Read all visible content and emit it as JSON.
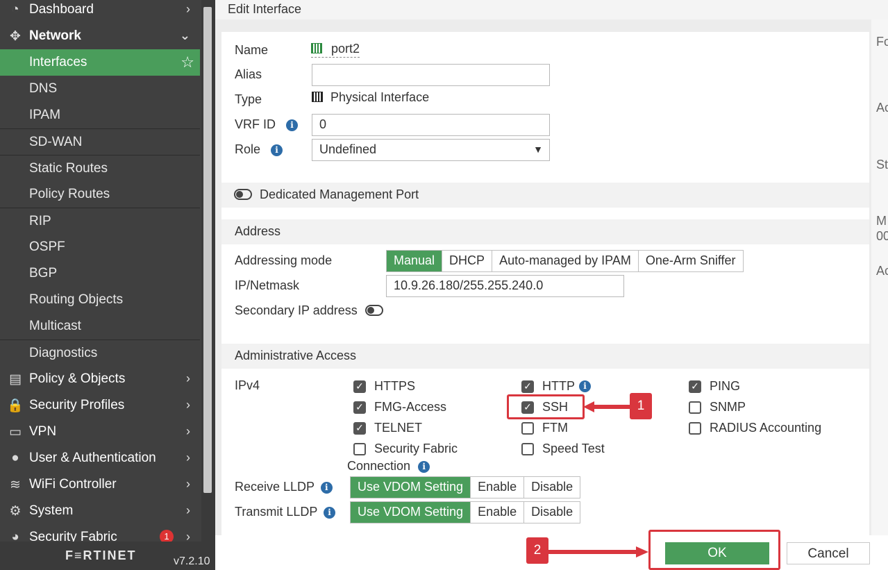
{
  "sidebar": {
    "items": [
      {
        "label": "Dashboard",
        "icon": "dashboard-icon",
        "glyph": "◔",
        "type": "top",
        "chevron": "›"
      },
      {
        "label": "Network",
        "icon": "network-icon",
        "glyph": "✥",
        "type": "top",
        "bold": true,
        "chevron": "⌄"
      },
      {
        "label": "Interfaces",
        "type": "sub",
        "active": true,
        "star": "☆"
      },
      {
        "label": "DNS",
        "type": "sub"
      },
      {
        "label": "IPAM",
        "type": "sub"
      },
      {
        "label": "SD-WAN",
        "type": "sub",
        "sep": true
      },
      {
        "label": "Static Routes",
        "type": "sub",
        "sep": true
      },
      {
        "label": "Policy Routes",
        "type": "sub"
      },
      {
        "label": "RIP",
        "type": "sub",
        "sep": true
      },
      {
        "label": "OSPF",
        "type": "sub"
      },
      {
        "label": "BGP",
        "type": "sub"
      },
      {
        "label": "Routing Objects",
        "type": "sub"
      },
      {
        "label": "Multicast",
        "type": "sub"
      },
      {
        "label": "Diagnostics",
        "type": "sub",
        "sep": true
      },
      {
        "label": "Policy & Objects",
        "icon": "policy-icon",
        "glyph": "▤",
        "type": "top",
        "chevron": "›"
      },
      {
        "label": "Security Profiles",
        "icon": "lock-icon",
        "glyph": "🔒",
        "type": "top",
        "chevron": "›"
      },
      {
        "label": "VPN",
        "icon": "monitor-icon",
        "glyph": "▭",
        "type": "top",
        "chevron": "›"
      },
      {
        "label": "User & Authentication",
        "icon": "user-icon",
        "glyph": "●",
        "type": "top",
        "chevron": "›"
      },
      {
        "label": "WiFi Controller",
        "icon": "wifi-icon",
        "glyph": "≋",
        "type": "top",
        "chevron": "›"
      },
      {
        "label": "System",
        "icon": "gear-icon",
        "glyph": "⚙",
        "type": "top",
        "chevron": "›"
      },
      {
        "label": "Security Fabric",
        "icon": "fabric-icon",
        "glyph": "◕",
        "type": "top",
        "chevron": "›",
        "badge": "1"
      }
    ],
    "brand": "F≡RTINET",
    "version": "v7.2.10"
  },
  "dialog": {
    "title": "Edit Interface",
    "name_label": "Name",
    "name_value": "port2",
    "alias_label": "Alias",
    "alias_value": "",
    "type_label": "Type",
    "type_value": "Physical Interface",
    "vrf_label": "VRF ID",
    "vrf_value": "0",
    "role_label": "Role",
    "role_value": "Undefined",
    "dedicated_mgmt_label": "Dedicated Management Port",
    "address_section": "Address",
    "addressing_mode_label": "Addressing mode",
    "addressing_modes": [
      "Manual",
      "DHCP",
      "Auto-managed by IPAM",
      "One-Arm Sniffer"
    ],
    "addressing_mode_selected": "Manual",
    "ip_label": "IP/Netmask",
    "ip_value": "10.9.26.180/255.255.240.0",
    "secondary_ip_label": "Secondary IP address",
    "admin_section": "Administrative Access",
    "ipv4_label": "IPv4",
    "access": {
      "https": {
        "label": "HTTPS",
        "checked": true
      },
      "fmg": {
        "label": "FMG-Access",
        "checked": true
      },
      "telnet": {
        "label": "TELNET",
        "checked": true
      },
      "sf": {
        "label": "Security Fabric",
        "label2": "Connection",
        "checked": false
      },
      "http": {
        "label": "HTTP",
        "checked": true
      },
      "ssh": {
        "label": "SSH",
        "checked": true
      },
      "ftm": {
        "label": "FTM",
        "checked": false
      },
      "speed": {
        "label": "Speed Test",
        "checked": false
      },
      "ping": {
        "label": "PING",
        "checked": true
      },
      "snmp": {
        "label": "SNMP",
        "checked": false
      },
      "radius": {
        "label": "RADIUS Accounting",
        "checked": false
      }
    },
    "receive_lldp_label": "Receive LLDP",
    "transmit_lldp_label": "Transmit LLDP",
    "lldp_options": [
      "Use VDOM Setting",
      "Enable",
      "Disable"
    ],
    "lldp_selected": "Use VDOM Setting",
    "ok_label": "OK",
    "cancel_label": "Cancel"
  },
  "annotations": {
    "step1": "1",
    "step2": "2",
    "color": "#d9363e"
  },
  "right_strip": [
    "Fo",
    "Ac",
    "St",
    "M",
    "00",
    "Ac"
  ],
  "colors": {
    "accent_green": "#4a9d5b",
    "sidebar": "#404040",
    "info_blue": "#2d6ca8"
  }
}
